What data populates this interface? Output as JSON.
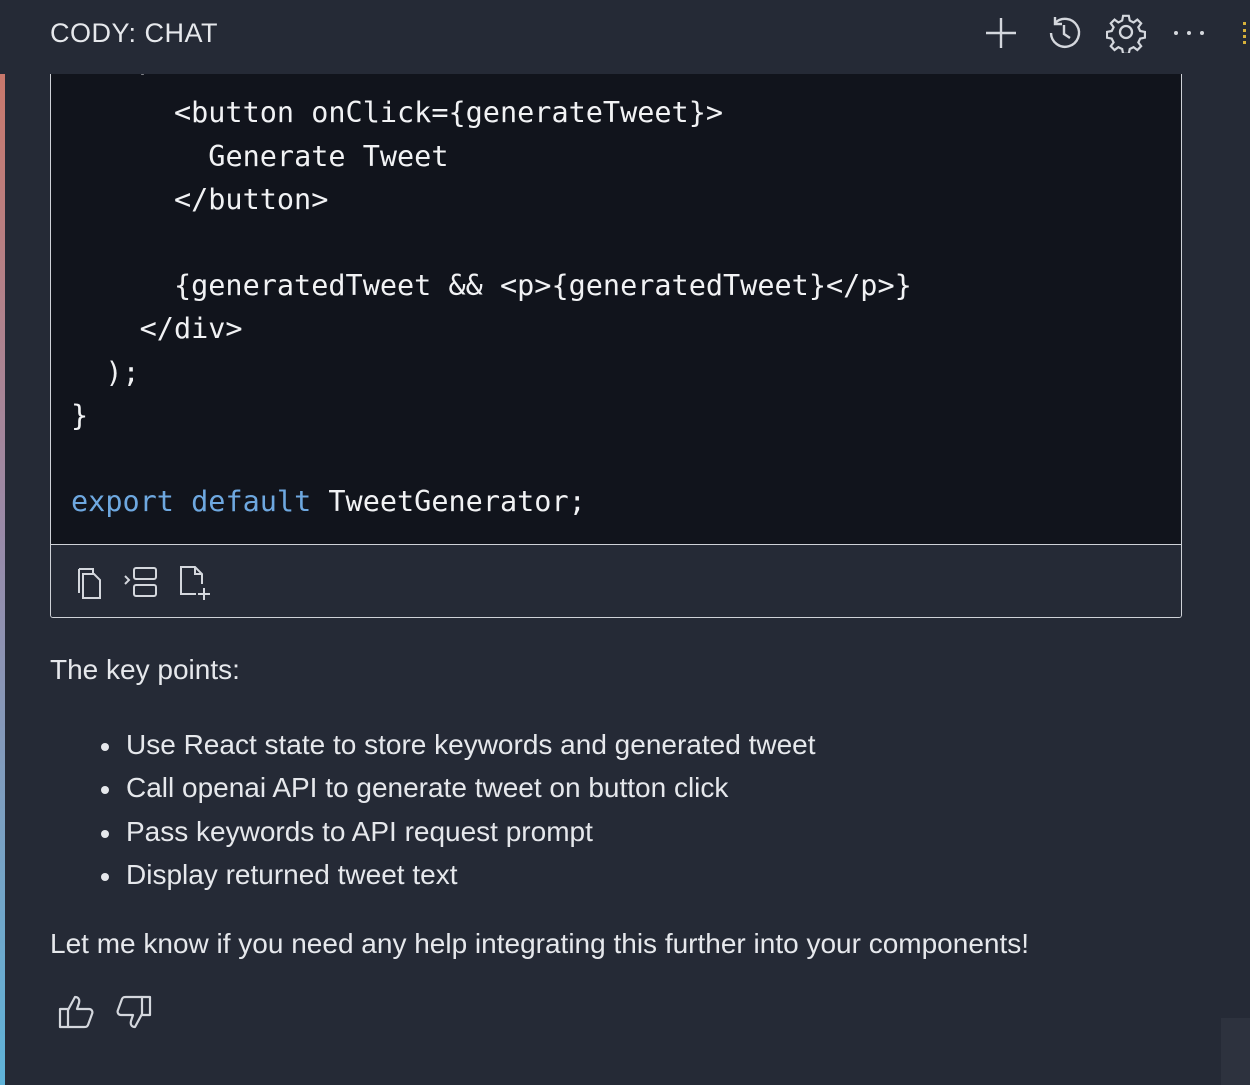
{
  "panel": {
    "title": "CODY: CHAT",
    "actions": [
      {
        "name": "new-chat",
        "icon": "plus-icon"
      },
      {
        "name": "history",
        "icon": "history-icon"
      },
      {
        "name": "settings",
        "icon": "gear-icon"
      },
      {
        "name": "more",
        "icon": "ellipsis-icon"
      }
    ]
  },
  "code_block": {
    "lines": [
      {
        "indent": "      ",
        "text": "<button onClick={generateTweet}>"
      },
      {
        "indent": "        ",
        "text": "Generate Tweet"
      },
      {
        "indent": "      ",
        "text": "</button>"
      },
      {
        "indent": "",
        "text": ""
      },
      {
        "indent": "      ",
        "text": "{generatedTweet && <p>{generatedTweet}</p>}"
      },
      {
        "indent": "    ",
        "text": "</div>"
      },
      {
        "indent": "  ",
        "text": ");"
      },
      {
        "indent": "",
        "text": "}"
      },
      {
        "indent": "",
        "text": ""
      }
    ],
    "export_line": {
      "keyword1": "export",
      "keyword2": "default",
      "rest": " TweetGenerator;"
    },
    "toolbar": [
      {
        "name": "copy-code",
        "icon": "copy-icon"
      },
      {
        "name": "insert-at-cursor",
        "icon": "insert-icon"
      },
      {
        "name": "save-to-new-file",
        "icon": "new-file-icon"
      }
    ]
  },
  "message": {
    "intro": "The key points:",
    "points": [
      "Use React state to store keywords and generated tweet",
      "Call openai API to generate tweet on button click",
      "Pass keywords to API request prompt",
      "Display returned tweet text"
    ],
    "closing": "Let me know if you need any help integrating this further into your components!"
  },
  "feedback": [
    {
      "name": "thumbs-up",
      "icon": "thumbs-up-icon"
    },
    {
      "name": "thumbs-down",
      "icon": "thumbs-down-icon"
    }
  ],
  "colors": {
    "panel_bg": "#252a36",
    "code_bg": "#11141c",
    "keyword": "#6ea8e0",
    "text": "#e6e8ec"
  }
}
